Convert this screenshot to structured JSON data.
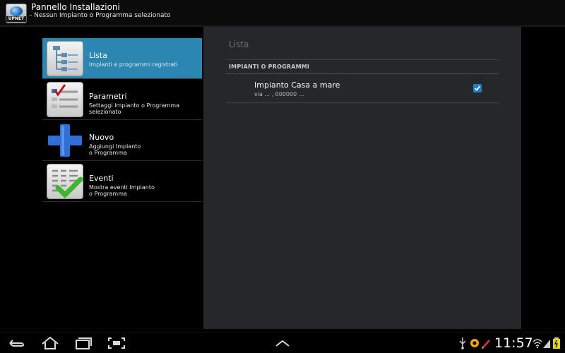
{
  "header": {
    "title": "Pannello Installazioni",
    "subtitle": "- Nessun Impianto o Programma selezionato",
    "app_icon_text": "UPNET"
  },
  "nav": {
    "items": [
      {
        "label": "Lista",
        "description": "Impianti e programmi registrati",
        "icon": "list-tree-icon",
        "active": true
      },
      {
        "label": "Parametri",
        "description": "Settaggi Impianto o Programma\nselezionato",
        "icon": "settings-checklist-icon",
        "active": false
      },
      {
        "label": "Nuovo",
        "description": "Aggiungi Impianto\n o Programma",
        "icon": "plus-icon",
        "active": false
      },
      {
        "label": "Eventi",
        "description": "Mostra eventi Impianto\n o Programma",
        "icon": "events-check-icon",
        "active": false
      }
    ]
  },
  "panel": {
    "title": "Lista",
    "section_header": "IMPIANTI O PROGRAMMI",
    "entries": [
      {
        "title": "Impianto Casa a mare",
        "subtitle": "via ... , 000000 ...",
        "checked": true
      }
    ]
  },
  "statusbar": {
    "time": "11:57"
  },
  "colors": {
    "accent": "#2b87b1",
    "panel_bg": "#26272b",
    "checkbox": "#1f7fc1"
  }
}
